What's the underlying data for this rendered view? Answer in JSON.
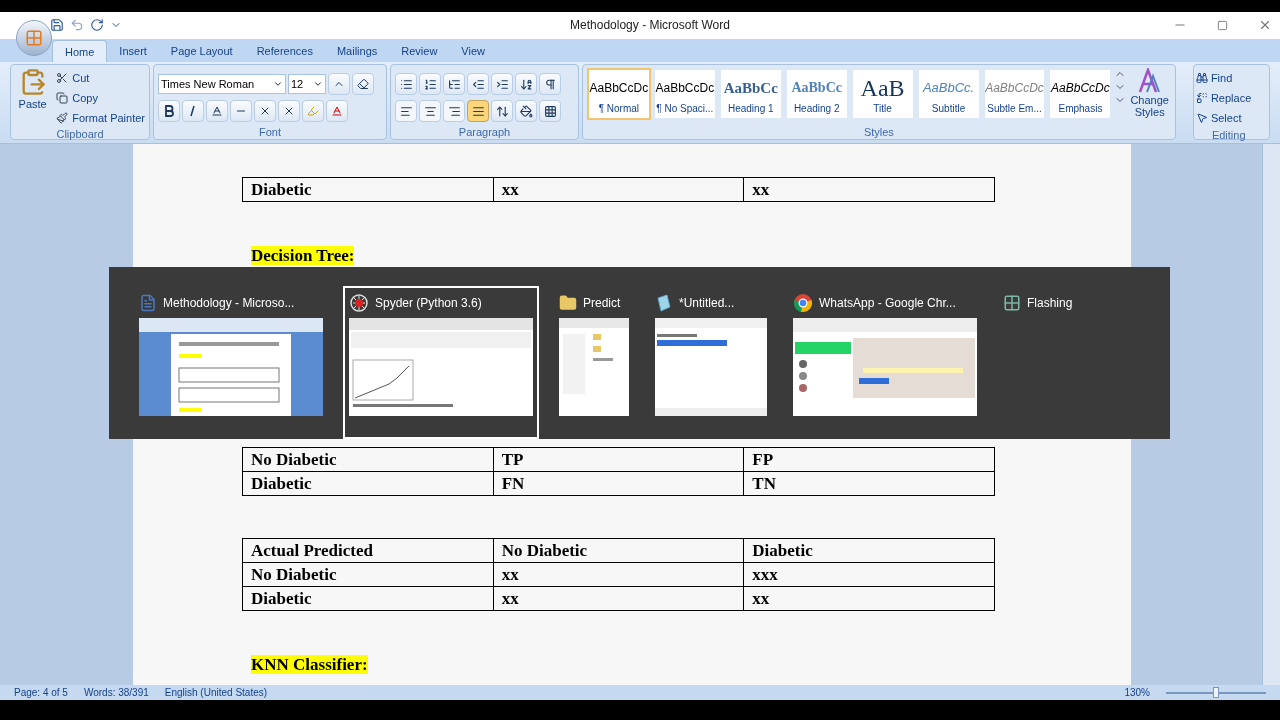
{
  "window": {
    "title": "Methodology - Microsoft Word"
  },
  "tabs": [
    {
      "label": "Home",
      "selected": true
    },
    {
      "label": "Insert",
      "selected": false
    },
    {
      "label": "Page Layout",
      "selected": false
    },
    {
      "label": "References",
      "selected": false
    },
    {
      "label": "Mailings",
      "selected": false
    },
    {
      "label": "Review",
      "selected": false
    },
    {
      "label": "View",
      "selected": false
    }
  ],
  "clipboard": {
    "label": "Clipboard",
    "paste": "Paste",
    "items": [
      {
        "kind": "cut",
        "label": "Cut"
      },
      {
        "kind": "copy",
        "label": "Copy"
      },
      {
        "kind": "painter",
        "label": "Format Painter"
      }
    ]
  },
  "font": {
    "label": "Font",
    "font_name": "Times New Roman",
    "font_size": "12"
  },
  "paragraph": {
    "label": "Paragraph",
    "alignment": [
      {
        "kind": "left",
        "selected": false
      },
      {
        "kind": "center",
        "selected": false
      },
      {
        "kind": "right",
        "selected": false
      },
      {
        "kind": "justify",
        "selected": true
      }
    ]
  },
  "styles": {
    "label": "Styles",
    "change_styles": "Change Styles",
    "items": [
      {
        "kind": "normal",
        "preview": "AaBbCcDc",
        "name": "¶ Normal",
        "selected": true
      },
      {
        "kind": "normal",
        "preview": "AaBbCcDc",
        "name": "¶ No Spaci...",
        "selected": false
      },
      {
        "kind": "heading1",
        "preview": "AaBbCc",
        "name": "Heading 1",
        "selected": false
      },
      {
        "kind": "heading2",
        "preview": "AaBbCc",
        "name": "Heading 2",
        "selected": false
      },
      {
        "kind": "title",
        "preview": "AaB",
        "name": "Title",
        "selected": false
      },
      {
        "kind": "subtitle",
        "preview": "AaBbCc.",
        "name": "Subtitle",
        "selected": false
      },
      {
        "kind": "subtle",
        "preview": "AaBbCcDc",
        "name": "Subtle Em...",
        "selected": false
      },
      {
        "kind": "emphasis",
        "preview": "AaBbCcDc",
        "name": "Emphasis",
        "selected": false
      }
    ]
  },
  "editing": {
    "label": "Editing",
    "items": [
      {
        "kind": "find",
        "label": "Find"
      },
      {
        "kind": "replace",
        "label": "Replace"
      },
      {
        "kind": "select",
        "label": "Select"
      }
    ]
  },
  "document": [
    {
      "kind": "table",
      "rows": [
        [
          "Diabetic",
          "xx",
          "xx"
        ]
      ]
    },
    {
      "kind": "heading",
      "text": "Decision Tree:"
    },
    {
      "kind": "covered"
    },
    {
      "kind": "table",
      "rows": [
        [
          "No Diabetic",
          "TP",
          "FP"
        ],
        [
          "Diabetic",
          "FN",
          "TN"
        ]
      ]
    },
    {
      "kind": "table",
      "rows": [
        [
          "Actual Predicted",
          "No Diabetic",
          "Diabetic"
        ],
        [
          "No Diabetic",
          "xx",
          "xxx"
        ],
        [
          "Diabetic",
          "xx",
          "xx"
        ]
      ]
    },
    {
      "kind": "heading",
      "text": "KNN Classifier:"
    }
  ],
  "switcher": [
    {
      "kind": "word",
      "title": "Methodology - Microso...",
      "selected": false
    },
    {
      "kind": "spyder",
      "title": "Spyder (Python 3.6)",
      "selected": true
    },
    {
      "kind": "folder",
      "title": "Predict",
      "selected": false
    },
    {
      "kind": "notepad",
      "title": "*Untitled...",
      "selected": false
    },
    {
      "kind": "chrome",
      "title": "WhatsApp - Google Chr...",
      "selected": false
    },
    {
      "kind": "app",
      "title": "Flashing",
      "selected": false
    }
  ],
  "status_bar": {
    "page": "Page: 4 of 5",
    "words": "Words: 38/391",
    "language": "English (United States)",
    "zoom": "130%",
    "level": 0.5
  }
}
